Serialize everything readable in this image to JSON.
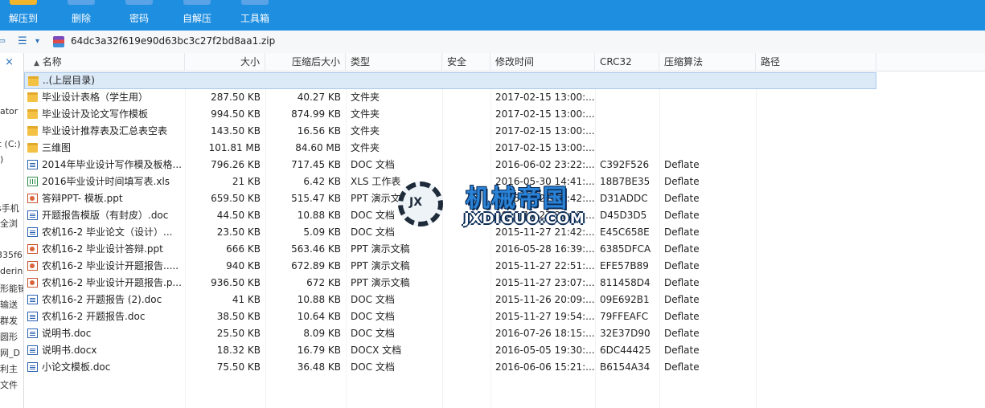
{
  "toolbar": {
    "items": [
      {
        "label": "解压到",
        "color": "#f0b52b"
      },
      {
        "label": "删除",
        "color": "#5aa3e6"
      },
      {
        "label": "密码",
        "color": "#5aa3e6"
      },
      {
        "label": "自解压",
        "color": "#5aa3e6"
      },
      {
        "label": "工具箱",
        "color": "#5aa3e6"
      }
    ]
  },
  "address": {
    "back_icon": "back-arrow-icon",
    "view_icon": "list-view-icon",
    "path": "64dc3a32f619e90d63bc3c27f2bd8aa1.zip"
  },
  "left_panel": {
    "close": "×",
    "fragments": [
      "ator",
      "c (C:)",
      ")",
      "s手机",
      "全浏",
      "335f6",
      "derin",
      "形能销",
      "输送",
      "群发",
      "圆形",
      "网_D",
      "利主",
      "文件"
    ]
  },
  "columns": {
    "name": "名称",
    "size": "大小",
    "packed": "压缩后大小",
    "type": "类型",
    "security": "安全",
    "modified": "修改时间",
    "crc": "CRC32",
    "method": "压缩算法",
    "path": "路径"
  },
  "parent_row": {
    "name": "..(上层目录)"
  },
  "rows": [
    {
      "icon": "folder",
      "name": "毕业设计表格（学生用）",
      "size": "287.50 KB",
      "packed": "40.27 KB",
      "type": "文件夹",
      "modified": "2017-02-15 13:00:...",
      "crc": "",
      "method": ""
    },
    {
      "icon": "folder",
      "name": "毕业设计及论文写作模板",
      "size": "994.50 KB",
      "packed": "874.99 KB",
      "type": "文件夹",
      "modified": "2017-02-15 13:00:...",
      "crc": "",
      "method": ""
    },
    {
      "icon": "folder",
      "name": "毕业设计推荐表及汇总表空表",
      "size": "143.50 KB",
      "packed": "16.56 KB",
      "type": "文件夹",
      "modified": "2017-02-15 13:00:...",
      "crc": "",
      "method": ""
    },
    {
      "icon": "folder",
      "name": "三维图",
      "size": "101.81 MB",
      "packed": "84.60 MB",
      "type": "文件夹",
      "modified": "2017-02-15 13:00:...",
      "crc": "",
      "method": ""
    },
    {
      "icon": "doc",
      "name": "2014年毕业设计写作模及板格...",
      "size": "796.26 KB",
      "packed": "717.45 KB",
      "type": "DOC 文档",
      "modified": "2016-06-02 23:22:...",
      "crc": "C392F526",
      "method": "Deflate"
    },
    {
      "icon": "xls",
      "name": "2016毕业设计时间填写表.xls",
      "size": "21 KB",
      "packed": "6.42 KB",
      "type": "XLS 工作表",
      "modified": "2016-05-30 14:41:...",
      "crc": "18B7BE35",
      "method": "Deflate"
    },
    {
      "icon": "ppt",
      "name": "答辩PPT- 模板.ppt",
      "size": "659.50 KB",
      "packed": "515.47 KB",
      "type": "PPT 演示文稿",
      "modified": "2015-11-27 21:42:...",
      "crc": "D31ADDC",
      "method": "Deflate"
    },
    {
      "icon": "doc",
      "name": "开题报告模版（有封皮）.doc",
      "size": "44.50 KB",
      "packed": "10.88 KB",
      "type": "DOC 文档",
      "modified": "2015-11-27 21:42:...",
      "crc": "D45D3D5",
      "method": "Deflate"
    },
    {
      "icon": "doc",
      "name": "农机16-2  毕业论文（设计）...",
      "size": "23.50 KB",
      "packed": "5.09 KB",
      "type": "DOC 文档",
      "modified": "2015-11-27 21:42:...",
      "crc": "E45C658E",
      "method": "Deflate"
    },
    {
      "icon": "ppt",
      "name": "农机16-2  毕业设计答辩.ppt",
      "size": "666 KB",
      "packed": "563.46 KB",
      "type": "PPT 演示文稿",
      "modified": "2016-05-28 16:39:...",
      "crc": "6385DFCA",
      "method": "Deflate"
    },
    {
      "icon": "ppt",
      "name": "农机16-2  毕业设计开题报告.....",
      "size": "940 KB",
      "packed": "672.89 KB",
      "type": "PPT 演示文稿",
      "modified": "2015-11-27 22:51:...",
      "crc": "EFE57B89",
      "method": "Deflate"
    },
    {
      "icon": "ppt",
      "name": "农机16-2  毕业设计开题报告.p...",
      "size": "936.50 KB",
      "packed": "672 KB",
      "type": "PPT 演示文稿",
      "modified": "2015-11-27 23:07:...",
      "crc": "811458D4",
      "method": "Deflate"
    },
    {
      "icon": "doc",
      "name": "农机16-2  开题报告 (2).doc",
      "size": "41 KB",
      "packed": "10.88 KB",
      "type": "DOC 文档",
      "modified": "2015-11-26 20:09:...",
      "crc": "09E692B1",
      "method": "Deflate"
    },
    {
      "icon": "doc",
      "name": "农机16-2  开题报告.doc",
      "size": "38.50 KB",
      "packed": "10.64 KB",
      "type": "DOC 文档",
      "modified": "2015-11-27 19:54:...",
      "crc": "79FFEAFC",
      "method": "Deflate"
    },
    {
      "icon": "doc",
      "name": "说明书.doc",
      "size": "25.50 KB",
      "packed": "8.09 KB",
      "type": "DOC 文档",
      "modified": "2016-07-26 18:15:...",
      "crc": "32E37D90",
      "method": "Deflate"
    },
    {
      "icon": "doc",
      "name": "说明书.docx",
      "size": "18.32 KB",
      "packed": "16.79 KB",
      "type": "DOCX 文档",
      "modified": "2016-05-05 19:30:...",
      "crc": "6DC44425",
      "method": "Deflate"
    },
    {
      "icon": "doc",
      "name": "小论文模板.doc",
      "size": "75.50 KB",
      "packed": "36.48 KB",
      "type": "DOC 文档",
      "modified": "2016-06-06 15:21:...",
      "crc": "B6154A34",
      "method": "Deflate"
    }
  ],
  "watermark": {
    "cn": "机械帝国",
    "en": "JXDIGUO.COM"
  }
}
